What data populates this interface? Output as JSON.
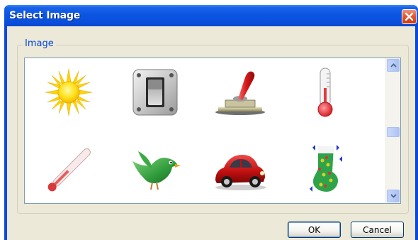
{
  "dialog": {
    "title": "Select Image",
    "close_icon": "close-icon"
  },
  "group": {
    "label": "Image"
  },
  "images": [
    {
      "name": "sun-icon"
    },
    {
      "name": "toggle-switch-icon"
    },
    {
      "name": "lever-switch-icon"
    },
    {
      "name": "thermometer-icon"
    },
    {
      "name": "thermometer-diagonal-icon"
    },
    {
      "name": "bird-icon"
    },
    {
      "name": "car-icon"
    },
    {
      "name": "christmas-stocking-icon"
    }
  ],
  "scrollbar": {
    "up_icon": "scroll-up-arrow-icon",
    "down_icon": "scroll-down-arrow-icon"
  },
  "buttons": {
    "ok_label": "OK",
    "cancel_label": "Cancel"
  },
  "colors": {
    "titlebar": "#0a4fdc",
    "close_button": "#e2552b",
    "dialog_face": "#ece9d8",
    "group_label": "#0046d5",
    "list_border": "#7f9db9"
  }
}
